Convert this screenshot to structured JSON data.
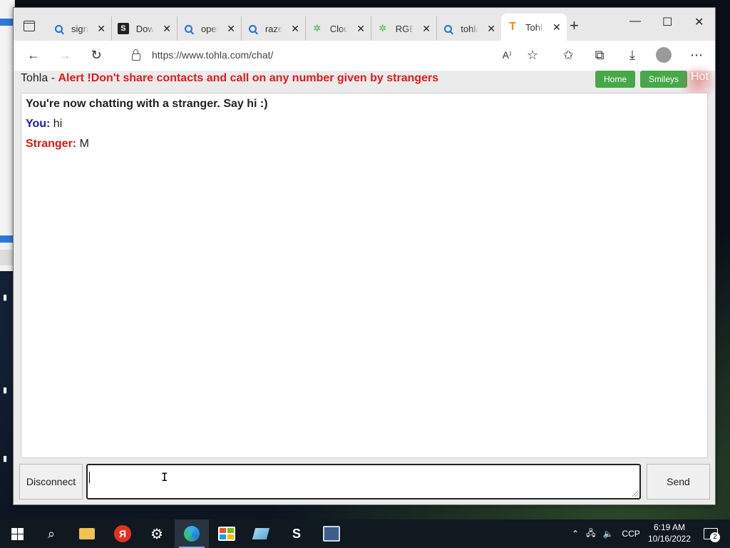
{
  "browser": {
    "tabs": [
      {
        "title": "sign",
        "favicon": "search-icon"
      },
      {
        "title": "Dow",
        "favicon": "s-icon"
      },
      {
        "title": "oper",
        "favicon": "search-icon"
      },
      {
        "title": "razer",
        "favicon": "search-icon"
      },
      {
        "title": "Clou",
        "favicon": "razer-icon"
      },
      {
        "title": "RGB",
        "favicon": "razer-icon"
      },
      {
        "title": "tohla",
        "favicon": "search-icon"
      },
      {
        "title": "Tohl",
        "favicon": "tohla-icon",
        "active": true
      }
    ],
    "url": "https://www.tohla.com/chat/"
  },
  "page": {
    "site_name": "Tohla - ",
    "alert": "Alert !Don't share contacts and call on any number given by strangers",
    "nav": {
      "home": "Home",
      "smileys": "Smileys",
      "hot": "Hot"
    }
  },
  "chat": {
    "system_message": "You're now chatting with a stranger. Say hi :)",
    "messages": [
      {
        "sender": "You:",
        "text": " hi"
      },
      {
        "sender": "Stranger:",
        "text": " M"
      }
    ],
    "input_value": "",
    "disconnect_label": "Disconnect",
    "send_label": "Send"
  },
  "taskbar": {
    "time": "6:19 AM",
    "date": "10/16/2022",
    "language": "CCP",
    "notification_count": "2"
  },
  "colors": {
    "alert": "#e31b1b",
    "nav_button": "#46a849",
    "you_label": "#1a1aaa",
    "stranger_label": "#d21a1a"
  }
}
